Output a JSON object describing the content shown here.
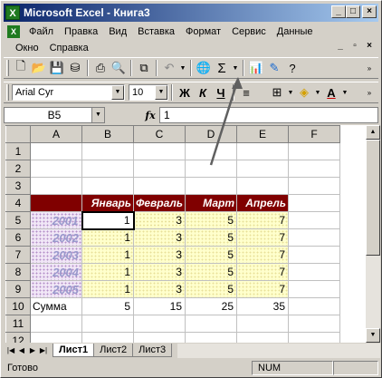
{
  "window": {
    "title": "Microsoft Excel - Книга3"
  },
  "menu": {
    "row1": [
      "Файл",
      "Правка",
      "Вид",
      "Вставка",
      "Формат",
      "Сервис",
      "Данные"
    ],
    "row2": [
      "Окно",
      "Справка"
    ]
  },
  "formatting": {
    "font": "Arial Cyr",
    "size": "10",
    "bold": "Ж",
    "italic": "К",
    "underline": "Ч"
  },
  "formula_bar": {
    "name_box": "B5",
    "fx": "fx",
    "value": "1"
  },
  "sheet": {
    "columns": [
      "A",
      "B",
      "C",
      "D",
      "E",
      "F"
    ],
    "rows": [
      "1",
      "2",
      "3",
      "4",
      "5",
      "6",
      "7",
      "8",
      "9",
      "10",
      "11",
      "12"
    ],
    "header_row": [
      "",
      "Январь",
      "Февраль",
      "Март",
      "Апрель"
    ],
    "data_rows": [
      {
        "year": "2001",
        "values": [
          "1",
          "3",
          "5",
          "7"
        ]
      },
      {
        "year": "2002",
        "values": [
          "1",
          "3",
          "5",
          "7"
        ]
      },
      {
        "year": "2003",
        "values": [
          "1",
          "3",
          "5",
          "7"
        ]
      },
      {
        "year": "2004",
        "values": [
          "1",
          "3",
          "5",
          "7"
        ]
      },
      {
        "year": "2005",
        "values": [
          "1",
          "3",
          "5",
          "7"
        ]
      }
    ],
    "sum_row": {
      "label": "Сумма",
      "values": [
        "5",
        "15",
        "25",
        "35"
      ]
    },
    "active_cell": "B5"
  },
  "tabs": [
    "Лист1",
    "Лист2",
    "Лист3"
  ],
  "status": {
    "ready": "Готово",
    "num": "NUM"
  },
  "colors": {
    "header_bg": "#800000",
    "title_grad_start": "#0a246a",
    "value_fill": "#ffffcc",
    "year_fill": "#f0e6f6"
  }
}
